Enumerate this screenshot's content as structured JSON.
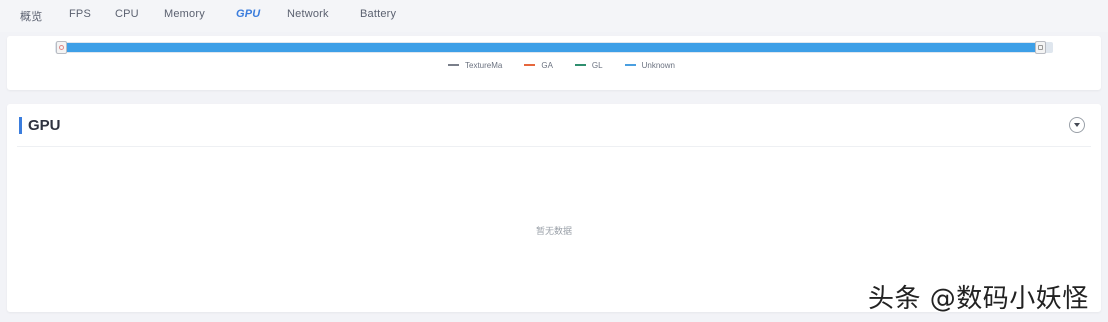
{
  "tabs": [
    {
      "label": "概览"
    },
    {
      "label": "FPS"
    },
    {
      "label": "CPU"
    },
    {
      "label": "Memory"
    },
    {
      "label": "GPU"
    },
    {
      "label": "Network"
    },
    {
      "label": "Battery"
    }
  ],
  "active_tab": "GPU",
  "chart_legend": {
    "items": [
      {
        "label": "TextureMa",
        "color": "#7a7f8a"
      },
      {
        "label": "GA",
        "color": "#e6673d"
      },
      {
        "label": "GL",
        "color": "#2f8f6f"
      },
      {
        "label": "Unknown",
        "color": "#4a9fe0"
      }
    ]
  },
  "range_slider": {
    "start_fraction": 0.0,
    "end_fraction": 1.0,
    "fill_color": "#3d9fe7"
  },
  "gpu_section": {
    "title": "GPU",
    "empty_message": "暂无数据",
    "accent_color": "#3b7ddd"
  },
  "watermark": "头条 @数码小妖怪"
}
